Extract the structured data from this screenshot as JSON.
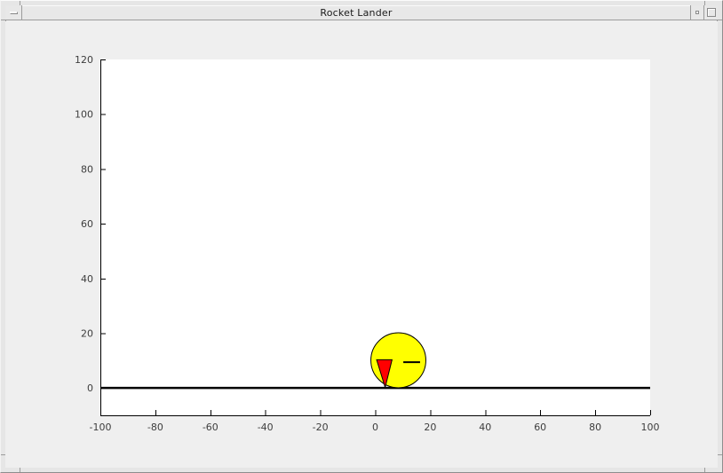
{
  "window": {
    "title": "Rocket Lander",
    "controls": {
      "menu_label": "window menu",
      "minimize_label": "minimize",
      "maximize_label": "maximize"
    }
  },
  "colors": {
    "figure_bg": "#efefef",
    "plot_bg": "#ffffff",
    "axis": "#000000",
    "tick_label": "#3d3d3d",
    "ground": "#000000",
    "lander_body": "#ffff00",
    "flame": "#ff0000",
    "outline": "#000000"
  },
  "chart_data": {
    "type": "scatter",
    "title": "",
    "xlabel": "",
    "ylabel": "",
    "grid": false,
    "legend": null,
    "xlim": [
      -100,
      100
    ],
    "ylim": [
      -10,
      120
    ],
    "xticks": [
      -100,
      -80,
      -60,
      -40,
      -20,
      0,
      20,
      40,
      60,
      80,
      100
    ],
    "yticks": [
      0,
      20,
      40,
      60,
      80,
      100,
      120
    ],
    "ground_line": {
      "y": 0,
      "x1": -100,
      "x2": 100
    },
    "lander": {
      "body": {
        "shape": "circle",
        "x": 8.4,
        "y": 10.1,
        "radius": 10
      },
      "flame": {
        "shape": "polygon",
        "points": [
          [
            0.5,
            10.3
          ],
          [
            6.1,
            10.3
          ],
          [
            3.6,
            0.2
          ]
        ]
      },
      "thrust_indicator": {
        "shape": "line",
        "x1": 10.2,
        "y1": 9.4,
        "x2": 16.3,
        "y2": 9.4
      }
    }
  }
}
